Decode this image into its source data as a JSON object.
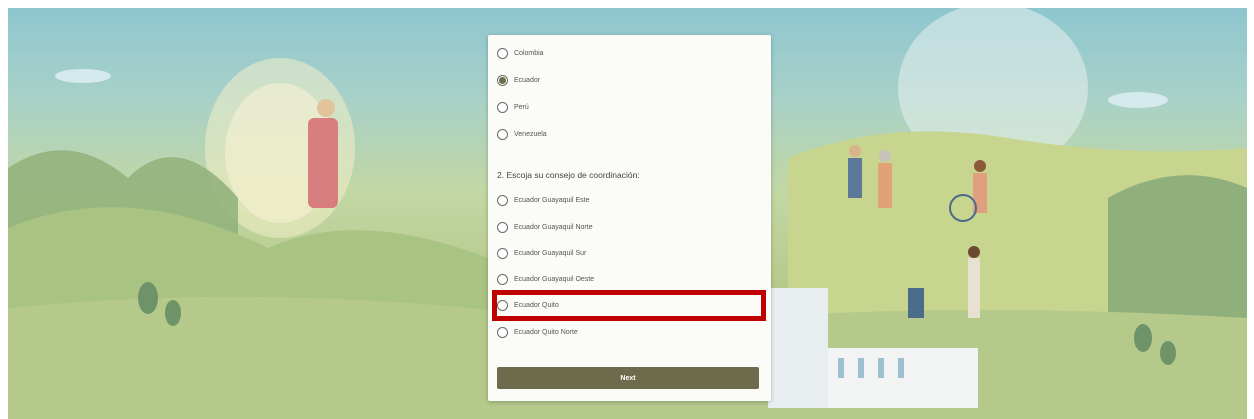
{
  "country_options": [
    {
      "label": "Colombia",
      "selected": false
    },
    {
      "label": "Ecuador",
      "selected": true
    },
    {
      "label": "Perú",
      "selected": false
    },
    {
      "label": "Venezuela",
      "selected": false
    }
  ],
  "question2": {
    "title": "2. Escoja su consejo de coordinación:",
    "options": [
      {
        "label": "Ecuador Guayaquil Este",
        "selected": false
      },
      {
        "label": "Ecuador Guayaquil Norte",
        "selected": false
      },
      {
        "label": "Ecuador Guayaquil Sur",
        "selected": false
      },
      {
        "label": "Ecuador Guayaquil Oeste",
        "selected": false
      },
      {
        "label": "Ecuador Quito",
        "selected": false
      },
      {
        "label": "Ecuador Quito Norte",
        "selected": false
      }
    ]
  },
  "next_label": "Next",
  "colors": {
    "accent": "#6d6b4b",
    "highlight": "#c00000"
  }
}
